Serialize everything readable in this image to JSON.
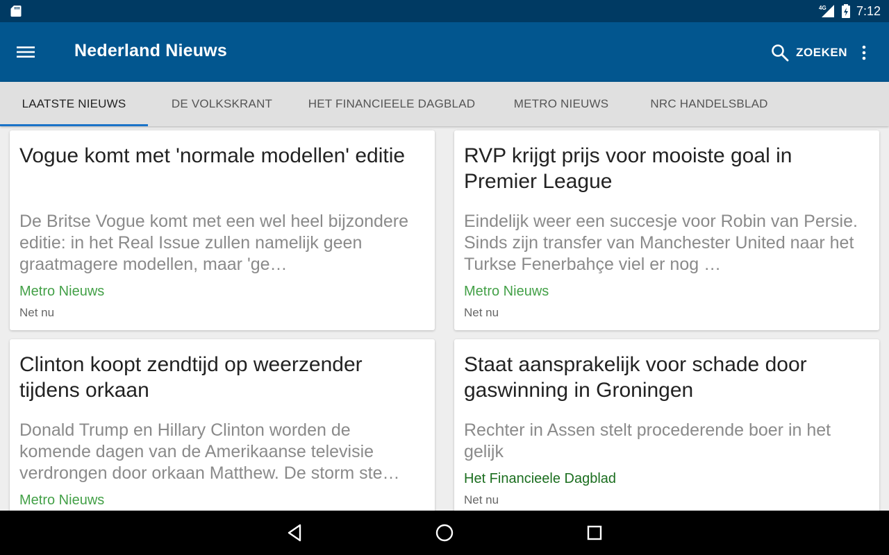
{
  "status_bar": {
    "time": "7:12",
    "network": "4G",
    "icons": [
      "sd-card-icon",
      "signal-icon",
      "battery-charging-icon"
    ]
  },
  "app_bar": {
    "title": "Nederland Nieuws",
    "menu_icon": "hamburger-menu-icon",
    "search_label": "ZOEKEN",
    "search_icon": "search-icon",
    "overflow_icon": "more-vert-icon",
    "background": "#02568f",
    "status_background": "#003a63"
  },
  "tabs": [
    {
      "label": "LAATSTE NIEUWS",
      "active": true
    },
    {
      "label": "DE VOLKSKRANT",
      "active": false
    },
    {
      "label": "HET FINANCIEELE DAGBLAD",
      "active": false
    },
    {
      "label": "METRO NIEUWS",
      "active": false
    },
    {
      "label": "NRC HANDELSBLAD",
      "active": false
    }
  ],
  "tab_indicator_color": "#1a73c8",
  "articles": [
    {
      "title": "Vogue komt met 'normale modellen' editie",
      "summary": "De Britse Vogue komt met een wel heel bijzondere editie: in het Real Issue zullen namelijk geen graatmagere modellen, maar 'ge…",
      "source": "Metro Nieuws",
      "source_color": "#43a047",
      "time": "Net nu"
    },
    {
      "title": "RVP krijgt prijs voor mooiste goal in Premier League",
      "summary": "Eindelijk weer een succesje voor Robin van Persie. Sinds zijn transfer van Manchester United naar het Turkse Fenerbahçe viel er nog …",
      "source": "Metro Nieuws",
      "source_color": "#43a047",
      "time": "Net nu"
    },
    {
      "title": "Clinton koopt zendtijd op weerzender tijdens orkaan",
      "summary": "Donald Trump en Hillary Clinton worden de komende dagen van de Amerikaanse televisie verdrongen door orkaan Matthew. De storm ste…",
      "source": "Metro Nieuws",
      "source_color": "#43a047",
      "time": ""
    },
    {
      "title": "Staat aansprakelijk voor schade door gaswinning in Groningen",
      "summary": "Rechter in Assen stelt procederende boer in het gelijk",
      "source": "Het Financieele Dagblad",
      "source_color": "#1b6e1f",
      "time": "Net nu"
    }
  ],
  "nav_bar": {
    "icons": [
      "back-icon",
      "home-icon",
      "recents-icon"
    ]
  }
}
